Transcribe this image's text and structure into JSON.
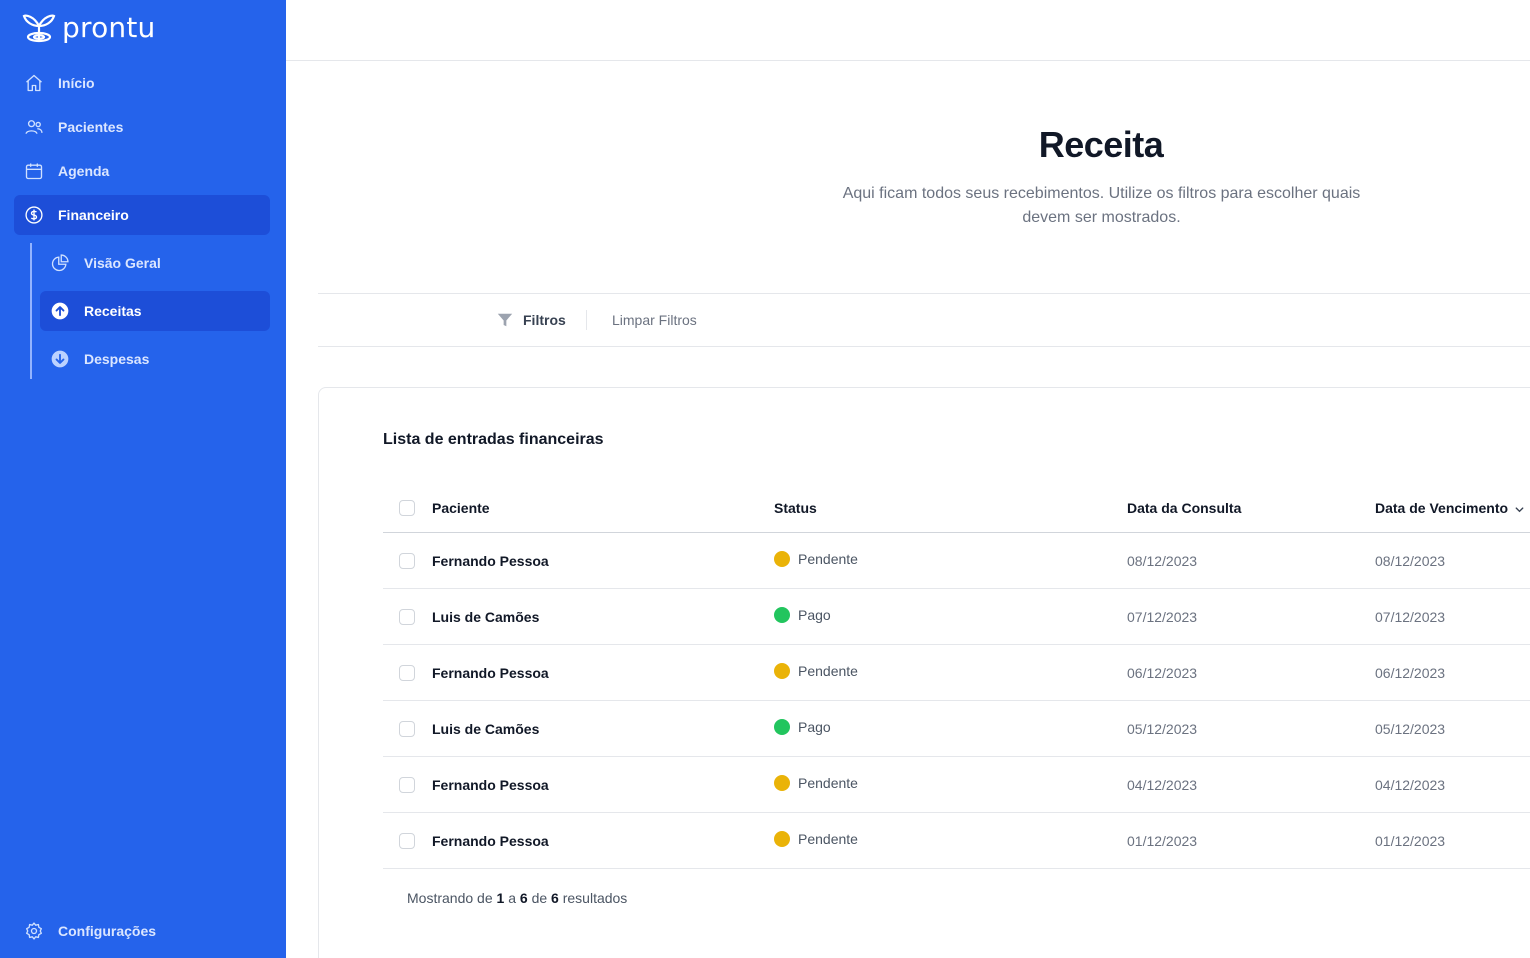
{
  "app": {
    "name": "prontu"
  },
  "sidebar": {
    "items": [
      {
        "label": "Início",
        "icon": "home-icon"
      },
      {
        "label": "Pacientes",
        "icon": "users-icon"
      },
      {
        "label": "Agenda",
        "icon": "calendar-icon"
      },
      {
        "label": "Financeiro",
        "icon": "dollar-circle-icon",
        "active": true
      }
    ],
    "subitems": [
      {
        "label": "Visão Geral",
        "icon": "pie-chart-icon"
      },
      {
        "label": "Receitas",
        "icon": "arrow-up-circle-icon",
        "active": true
      },
      {
        "label": "Despesas",
        "icon": "arrow-down-circle-icon"
      }
    ],
    "footer": {
      "label": "Configurações",
      "icon": "gear-icon"
    }
  },
  "page": {
    "title": "Receita",
    "subtitle": "Aqui ficam todos seus recebimentos. Utilize os filtros para escolher quais devem ser mostrados."
  },
  "filters": {
    "filter_label": "Filtros",
    "clear_label": "Limpar Filtros"
  },
  "table": {
    "title": "Lista de entradas financeiras",
    "columns": [
      "Paciente",
      "Status",
      "Data da Consulta",
      "Data de Vencimento"
    ],
    "rows": [
      {
        "patient": "Fernando Pessoa",
        "status": "Pendente",
        "consult_date": "08/12/2023",
        "due_date": "08/12/2023"
      },
      {
        "patient": "Luis de Camões",
        "status": "Pago",
        "consult_date": "07/12/2023",
        "due_date": "07/12/2023"
      },
      {
        "patient": "Fernando Pessoa",
        "status": "Pendente",
        "consult_date": "06/12/2023",
        "due_date": "06/12/2023"
      },
      {
        "patient": "Luis de Camões",
        "status": "Pago",
        "consult_date": "05/12/2023",
        "due_date": "05/12/2023"
      },
      {
        "patient": "Fernando Pessoa",
        "status": "Pendente",
        "consult_date": "04/12/2023",
        "due_date": "04/12/2023"
      },
      {
        "patient": "Fernando Pessoa",
        "status": "Pendente",
        "consult_date": "01/12/2023",
        "due_date": "01/12/2023"
      }
    ],
    "footer": {
      "prefix": "Mostrando de",
      "from": "1",
      "to_word": "a",
      "to": "6",
      "of_word": "de",
      "total": "6",
      "suffix": "resultados"
    }
  },
  "colors": {
    "sidebar_bg": "#2563eb",
    "sidebar_active": "#1d4ed8",
    "status_pendente": "#eab308",
    "status_pago": "#22c55e"
  }
}
